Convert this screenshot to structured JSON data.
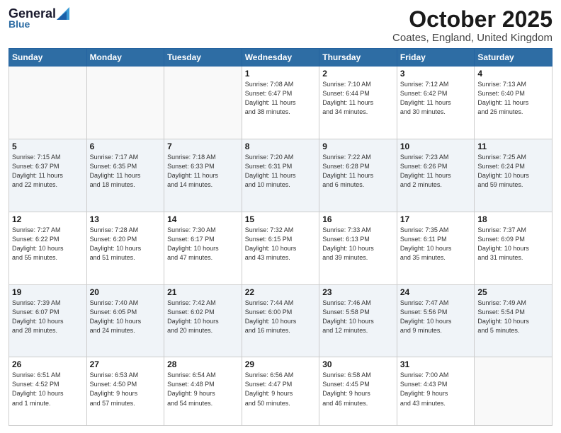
{
  "logo": {
    "line1": "General",
    "line2": "Blue"
  },
  "title": "October 2025",
  "location": "Coates, England, United Kingdom",
  "days_header": [
    "Sunday",
    "Monday",
    "Tuesday",
    "Wednesday",
    "Thursday",
    "Friday",
    "Saturday"
  ],
  "weeks": [
    {
      "alt": false,
      "days": [
        {
          "num": "",
          "info": ""
        },
        {
          "num": "",
          "info": ""
        },
        {
          "num": "",
          "info": ""
        },
        {
          "num": "1",
          "info": "Sunrise: 7:08 AM\nSunset: 6:47 PM\nDaylight: 11 hours\nand 38 minutes."
        },
        {
          "num": "2",
          "info": "Sunrise: 7:10 AM\nSunset: 6:44 PM\nDaylight: 11 hours\nand 34 minutes."
        },
        {
          "num": "3",
          "info": "Sunrise: 7:12 AM\nSunset: 6:42 PM\nDaylight: 11 hours\nand 30 minutes."
        },
        {
          "num": "4",
          "info": "Sunrise: 7:13 AM\nSunset: 6:40 PM\nDaylight: 11 hours\nand 26 minutes."
        }
      ]
    },
    {
      "alt": true,
      "days": [
        {
          "num": "5",
          "info": "Sunrise: 7:15 AM\nSunset: 6:37 PM\nDaylight: 11 hours\nand 22 minutes."
        },
        {
          "num": "6",
          "info": "Sunrise: 7:17 AM\nSunset: 6:35 PM\nDaylight: 11 hours\nand 18 minutes."
        },
        {
          "num": "7",
          "info": "Sunrise: 7:18 AM\nSunset: 6:33 PM\nDaylight: 11 hours\nand 14 minutes."
        },
        {
          "num": "8",
          "info": "Sunrise: 7:20 AM\nSunset: 6:31 PM\nDaylight: 11 hours\nand 10 minutes."
        },
        {
          "num": "9",
          "info": "Sunrise: 7:22 AM\nSunset: 6:28 PM\nDaylight: 11 hours\nand 6 minutes."
        },
        {
          "num": "10",
          "info": "Sunrise: 7:23 AM\nSunset: 6:26 PM\nDaylight: 11 hours\nand 2 minutes."
        },
        {
          "num": "11",
          "info": "Sunrise: 7:25 AM\nSunset: 6:24 PM\nDaylight: 10 hours\nand 59 minutes."
        }
      ]
    },
    {
      "alt": false,
      "days": [
        {
          "num": "12",
          "info": "Sunrise: 7:27 AM\nSunset: 6:22 PM\nDaylight: 10 hours\nand 55 minutes."
        },
        {
          "num": "13",
          "info": "Sunrise: 7:28 AM\nSunset: 6:20 PM\nDaylight: 10 hours\nand 51 minutes."
        },
        {
          "num": "14",
          "info": "Sunrise: 7:30 AM\nSunset: 6:17 PM\nDaylight: 10 hours\nand 47 minutes."
        },
        {
          "num": "15",
          "info": "Sunrise: 7:32 AM\nSunset: 6:15 PM\nDaylight: 10 hours\nand 43 minutes."
        },
        {
          "num": "16",
          "info": "Sunrise: 7:33 AM\nSunset: 6:13 PM\nDaylight: 10 hours\nand 39 minutes."
        },
        {
          "num": "17",
          "info": "Sunrise: 7:35 AM\nSunset: 6:11 PM\nDaylight: 10 hours\nand 35 minutes."
        },
        {
          "num": "18",
          "info": "Sunrise: 7:37 AM\nSunset: 6:09 PM\nDaylight: 10 hours\nand 31 minutes."
        }
      ]
    },
    {
      "alt": true,
      "days": [
        {
          "num": "19",
          "info": "Sunrise: 7:39 AM\nSunset: 6:07 PM\nDaylight: 10 hours\nand 28 minutes."
        },
        {
          "num": "20",
          "info": "Sunrise: 7:40 AM\nSunset: 6:05 PM\nDaylight: 10 hours\nand 24 minutes."
        },
        {
          "num": "21",
          "info": "Sunrise: 7:42 AM\nSunset: 6:02 PM\nDaylight: 10 hours\nand 20 minutes."
        },
        {
          "num": "22",
          "info": "Sunrise: 7:44 AM\nSunset: 6:00 PM\nDaylight: 10 hours\nand 16 minutes."
        },
        {
          "num": "23",
          "info": "Sunrise: 7:46 AM\nSunset: 5:58 PM\nDaylight: 10 hours\nand 12 minutes."
        },
        {
          "num": "24",
          "info": "Sunrise: 7:47 AM\nSunset: 5:56 PM\nDaylight: 10 hours\nand 9 minutes."
        },
        {
          "num": "25",
          "info": "Sunrise: 7:49 AM\nSunset: 5:54 PM\nDaylight: 10 hours\nand 5 minutes."
        }
      ]
    },
    {
      "alt": false,
      "days": [
        {
          "num": "26",
          "info": "Sunrise: 6:51 AM\nSunset: 4:52 PM\nDaylight: 10 hours\nand 1 minute."
        },
        {
          "num": "27",
          "info": "Sunrise: 6:53 AM\nSunset: 4:50 PM\nDaylight: 9 hours\nand 57 minutes."
        },
        {
          "num": "28",
          "info": "Sunrise: 6:54 AM\nSunset: 4:48 PM\nDaylight: 9 hours\nand 54 minutes."
        },
        {
          "num": "29",
          "info": "Sunrise: 6:56 AM\nSunset: 4:47 PM\nDaylight: 9 hours\nand 50 minutes."
        },
        {
          "num": "30",
          "info": "Sunrise: 6:58 AM\nSunset: 4:45 PM\nDaylight: 9 hours\nand 46 minutes."
        },
        {
          "num": "31",
          "info": "Sunrise: 7:00 AM\nSunset: 4:43 PM\nDaylight: 9 hours\nand 43 minutes."
        },
        {
          "num": "",
          "info": ""
        }
      ]
    }
  ]
}
